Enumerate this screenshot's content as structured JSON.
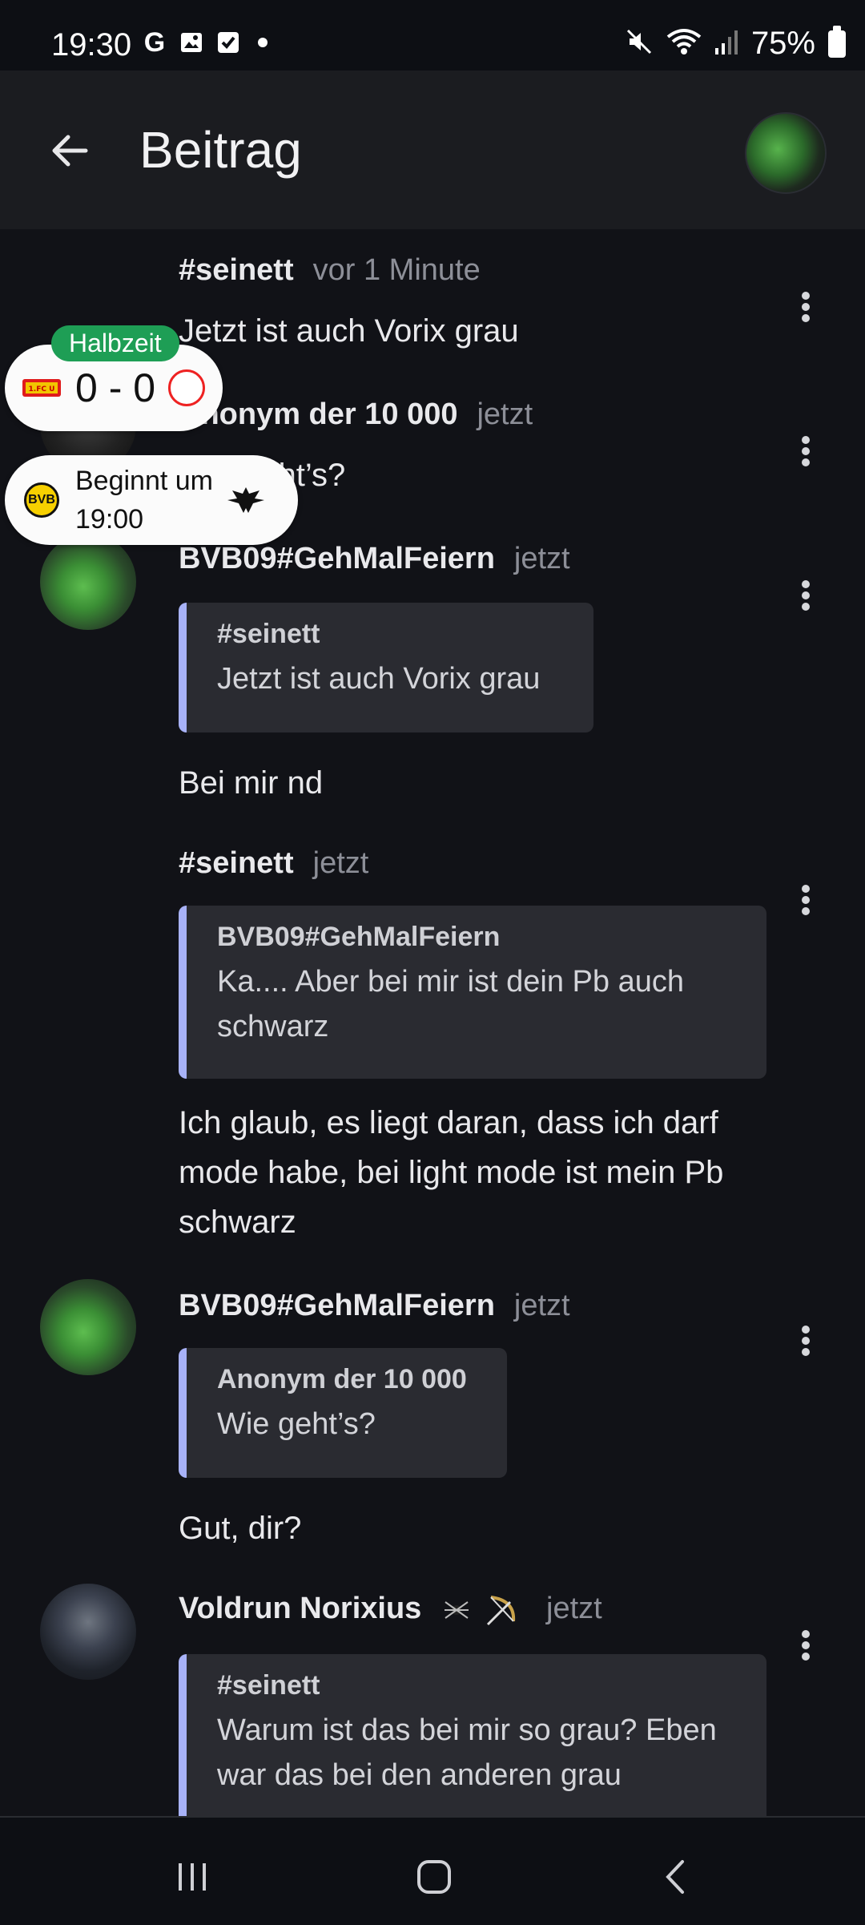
{
  "status_bar": {
    "time": "19:30",
    "left_icons": [
      "google-g",
      "image",
      "checkbox",
      "dot"
    ],
    "right_icons": [
      "mute",
      "wifi",
      "signal"
    ],
    "battery": "75%"
  },
  "app_bar": {
    "title": "Beitrag"
  },
  "score_widgets": {
    "live": {
      "badge": "Halbzeit",
      "score": "0 - 0"
    },
    "upcoming": {
      "line1": "Beginnt um",
      "line2": "19:00"
    }
  },
  "messages": [
    {
      "author": "#seinett",
      "time": "vor 1 Minute",
      "text": "Jetzt ist auch Vorix grau"
    },
    {
      "author": "Anonym der 10 000",
      "time": "jetzt",
      "text": "Wie geht’s?"
    },
    {
      "author": "BVB09#GehMalFeiern",
      "time": "jetzt",
      "quote": {
        "author": "#seinett",
        "text": "Jetzt ist auch Vorix grau"
      },
      "text": "Bei mir nd"
    },
    {
      "author": "#seinett",
      "time": "jetzt",
      "quote": {
        "author": "BVB09#GehMalFeiern",
        "text": "Ka.... Aber bei mir ist dein Pb auch schwarz"
      },
      "text": "Ich glaub, es liegt daran, dass ich darf mode habe, bei light mode ist mein Pb schwarz"
    },
    {
      "author": "BVB09#GehMalFeiern",
      "time": "jetzt",
      "quote": {
        "author": "Anonym der 10 000",
        "text": "Wie geht’s?"
      },
      "text": "Gut, dir?"
    },
    {
      "author": "Voldrun Norixius",
      "time": "jetzt",
      "quote": {
        "author": "#seinett",
        "text": "Warum ist das bei mir so grau? Eben war das bei den anderen grau"
      }
    }
  ],
  "colors": {
    "background": "#111217",
    "app_bar": "#1b1c20",
    "quote_bar": "#a8b2f8",
    "badge_green": "#1e9e55"
  }
}
